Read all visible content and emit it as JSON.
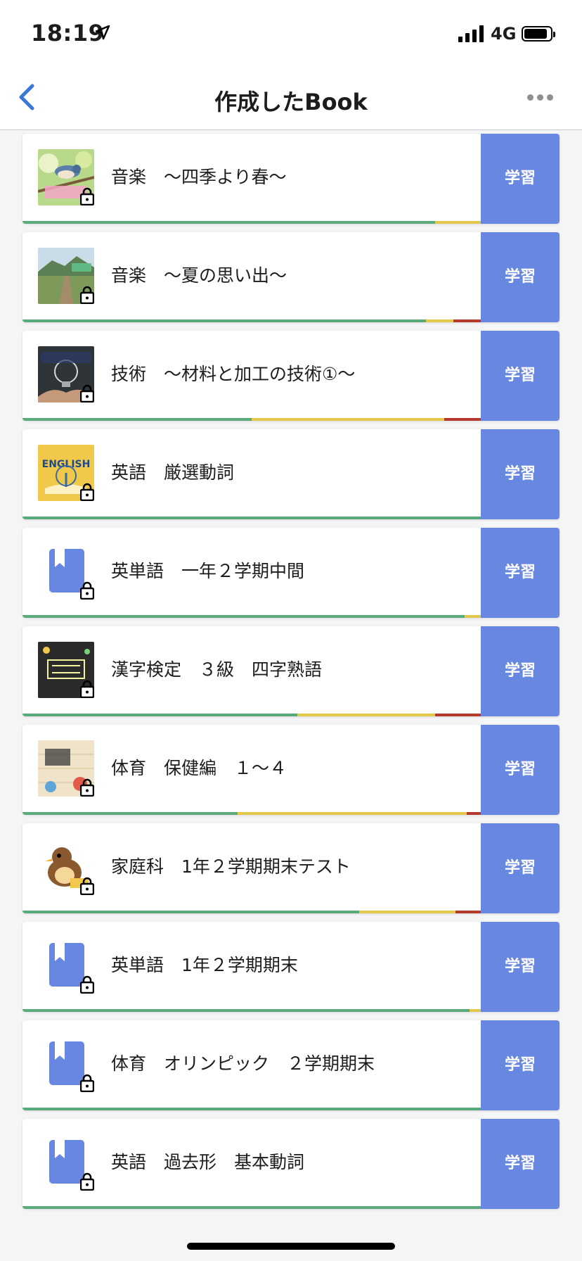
{
  "status": {
    "time": "18:19",
    "network": "4G"
  },
  "nav": {
    "title": "作成したBook"
  },
  "colors": {
    "accent": "#6787e0",
    "green": "#5aaa7a",
    "yellow": "#e3c94a",
    "red": "#b43a2e",
    "back": "#3a78d8"
  },
  "books": [
    {
      "title": "音楽　～四季より春～",
      "action": "学習",
      "thumb": "spring-bird",
      "progress": [
        0.9,
        0.1,
        0.0
      ]
    },
    {
      "title": "音楽　～夏の思い出～",
      "action": "学習",
      "thumb": "summer-marsh",
      "progress": [
        0.88,
        0.06,
        0.06
      ]
    },
    {
      "title": "技術　～材料と加工の技術①～",
      "action": "学習",
      "thumb": "lightbulb-hands",
      "progress": [
        0.5,
        0.42,
        0.08
      ]
    },
    {
      "title": "英語　厳選動詞",
      "action": "学習",
      "thumb": "english-book",
      "progress": [
        1.0,
        0.0,
        0.0
      ]
    },
    {
      "title": "英単語　一年２学期中間",
      "action": "学習",
      "thumb": "book-icon",
      "progress": [
        0.965,
        0.035,
        0.0
      ]
    },
    {
      "title": "漢字検定　３級　四字熟語",
      "action": "学習",
      "thumb": "kanji-chalkboard",
      "progress": [
        0.6,
        0.3,
        0.1
      ]
    },
    {
      "title": "体育　保健編　１～４",
      "action": "学習",
      "thumb": "health-paper",
      "progress": [
        0.47,
        0.5,
        0.03
      ]
    },
    {
      "title": "家庭科　1年２学期期末テスト",
      "action": "学習",
      "thumb": "bird-illustration",
      "progress": [
        0.735,
        0.21,
        0.055
      ]
    },
    {
      "title": "英単語　1年２学期期末",
      "action": "学習",
      "thumb": "book-icon",
      "progress": [
        0.975,
        0.025,
        0.0
      ]
    },
    {
      "title": "体育　オリンピック　２学期期末",
      "action": "学習",
      "thumb": "book-icon",
      "progress": [
        1.0,
        0.0,
        0.0
      ]
    },
    {
      "title": "英語　過去形　基本動詞",
      "action": "学習",
      "thumb": "book-icon",
      "progress": [
        1.0,
        0.0,
        0.0
      ]
    }
  ]
}
